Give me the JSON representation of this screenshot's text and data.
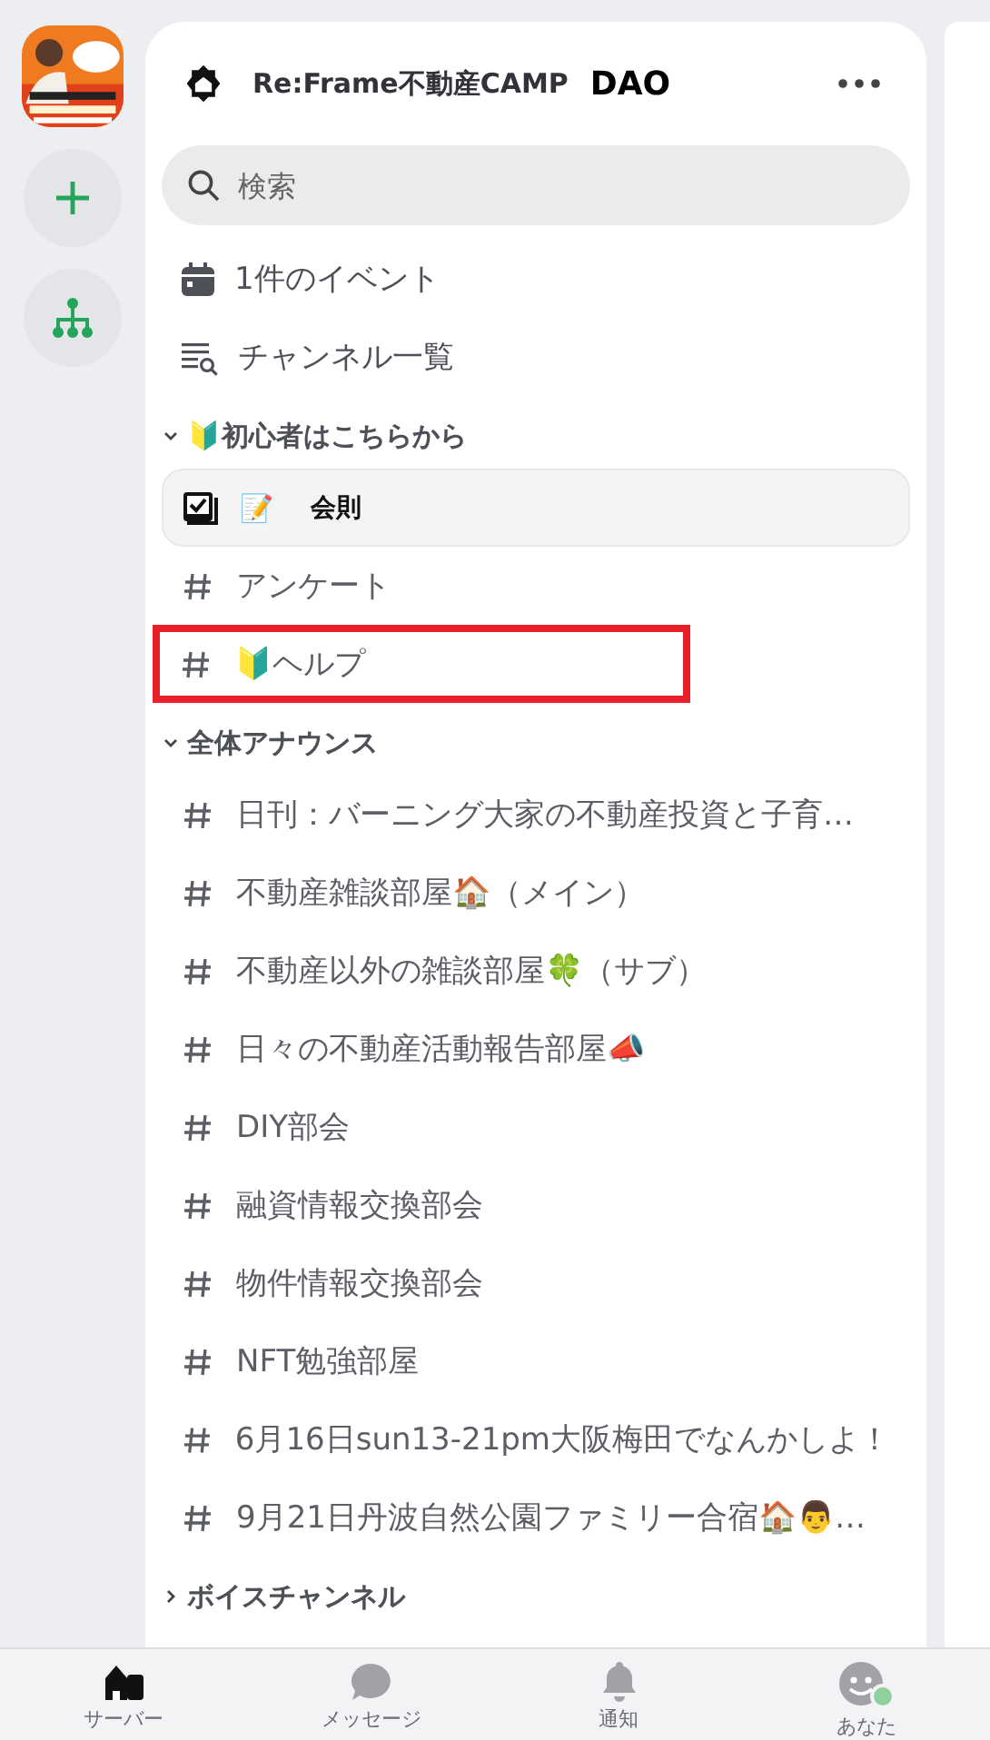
{
  "server": {
    "name": "Re:Frame不動産CAMP",
    "suffix": "DAO"
  },
  "search": {
    "placeholder": "検索"
  },
  "shortcuts": [
    {
      "kind": "events",
      "label": "1件のイベント"
    },
    {
      "kind": "browse",
      "label": "チャンネル一覧"
    }
  ],
  "categories": [
    {
      "name": "🔰初心者はこちらから",
      "expanded": true,
      "channels": [
        {
          "kind": "rules",
          "emoji": "📝",
          "name": "会則",
          "selected": true,
          "highlighted": false
        },
        {
          "kind": "text",
          "name": "アンケート",
          "selected": false,
          "highlighted": false
        },
        {
          "kind": "text",
          "name": "🔰ヘルプ",
          "selected": false,
          "highlighted": true
        }
      ]
    },
    {
      "name": "全体アナウンス",
      "expanded": true,
      "channels": [
        {
          "kind": "text",
          "name": "日刊：バーニング大家の不動産投資と子育…",
          "selected": false,
          "highlighted": false
        },
        {
          "kind": "text",
          "name": "不動産雑談部屋🏠（メイン）",
          "selected": false,
          "highlighted": false
        },
        {
          "kind": "text",
          "name": "不動産以外の雑談部屋🍀（サブ）",
          "selected": false,
          "highlighted": false
        },
        {
          "kind": "text",
          "name": "日々の不動産活動報告部屋📣",
          "selected": false,
          "highlighted": false
        },
        {
          "kind": "text",
          "name": "DIY部会",
          "selected": false,
          "highlighted": false
        },
        {
          "kind": "text",
          "name": "融資情報交換部会",
          "selected": false,
          "highlighted": false
        },
        {
          "kind": "text",
          "name": "物件情報交換部会",
          "selected": false,
          "highlighted": false
        },
        {
          "kind": "text",
          "name": "NFT勉強部屋",
          "selected": false,
          "highlighted": false
        },
        {
          "kind": "text",
          "name": "6月16日sun13-21pm大阪梅田でなんかしよ！",
          "selected": false,
          "highlighted": false
        },
        {
          "kind": "text",
          "name": "9月21日丹波自然公園ファミリー合宿🏠👨…",
          "selected": false,
          "highlighted": false
        }
      ]
    },
    {
      "name": "ボイスチャンネル",
      "expanded": false
    }
  ],
  "nav": [
    {
      "kind": "server",
      "label": "サーバー",
      "selected": true
    },
    {
      "kind": "messages",
      "label": "メッセージ",
      "selected": false
    },
    {
      "kind": "notifications",
      "label": "通知",
      "selected": false
    },
    {
      "kind": "you",
      "label": "あなた",
      "selected": false
    }
  ]
}
